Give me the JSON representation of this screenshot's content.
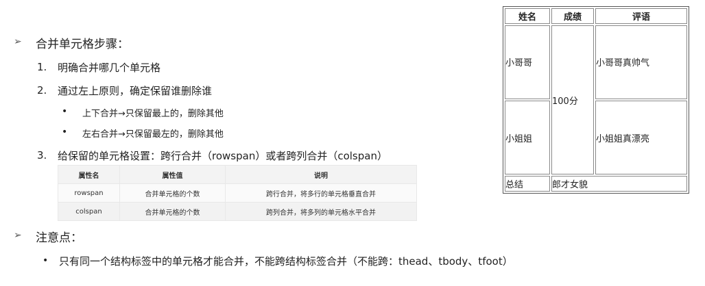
{
  "section1": {
    "marker": "➢",
    "title": "合并单元格步骤：",
    "steps": [
      {
        "num": "1.",
        "text": "明确合并哪几个单元格"
      },
      {
        "num": "2.",
        "text": "通过左上原则，确定保留谁删除谁"
      },
      {
        "num": "3.",
        "text": "给保留的单元格设置：跨行合并（rowspan）或者跨列合并（colspan）"
      }
    ],
    "sub_bullets": [
      {
        "dot": "•",
        "text": "上下合并→只保留最上的，删除其他"
      },
      {
        "dot": "•",
        "text": "左右合并→只保留最左的，删除其他"
      }
    ]
  },
  "attr_table": {
    "headers": [
      "属性名",
      "属性值",
      "说明"
    ],
    "rows": [
      [
        "rowspan",
        "合并单元格的个数",
        "跨行合并，将多行的单元格垂直合并"
      ],
      [
        "colspan",
        "合并单元格的个数",
        "跨列合并，将多列的单元格水平合并"
      ]
    ]
  },
  "section2": {
    "marker": "➢",
    "title": "注意点：",
    "bullets": [
      {
        "dot": "•",
        "text": "只有同一个结构标签中的单元格才能合并，不能跨结构标签合并（不能跨：thead、tbody、tfoot）"
      }
    ]
  },
  "demo_table": {
    "headers": [
      "姓名",
      "成绩",
      "评语"
    ],
    "row1": {
      "name": "小哥哥",
      "score": "100分",
      "comment": "小哥哥真帅气"
    },
    "row2": {
      "name": "小姐姐",
      "comment": "小姐姐真漂亮"
    },
    "footer": {
      "label": "总结",
      "value": "郎才女貌"
    }
  }
}
